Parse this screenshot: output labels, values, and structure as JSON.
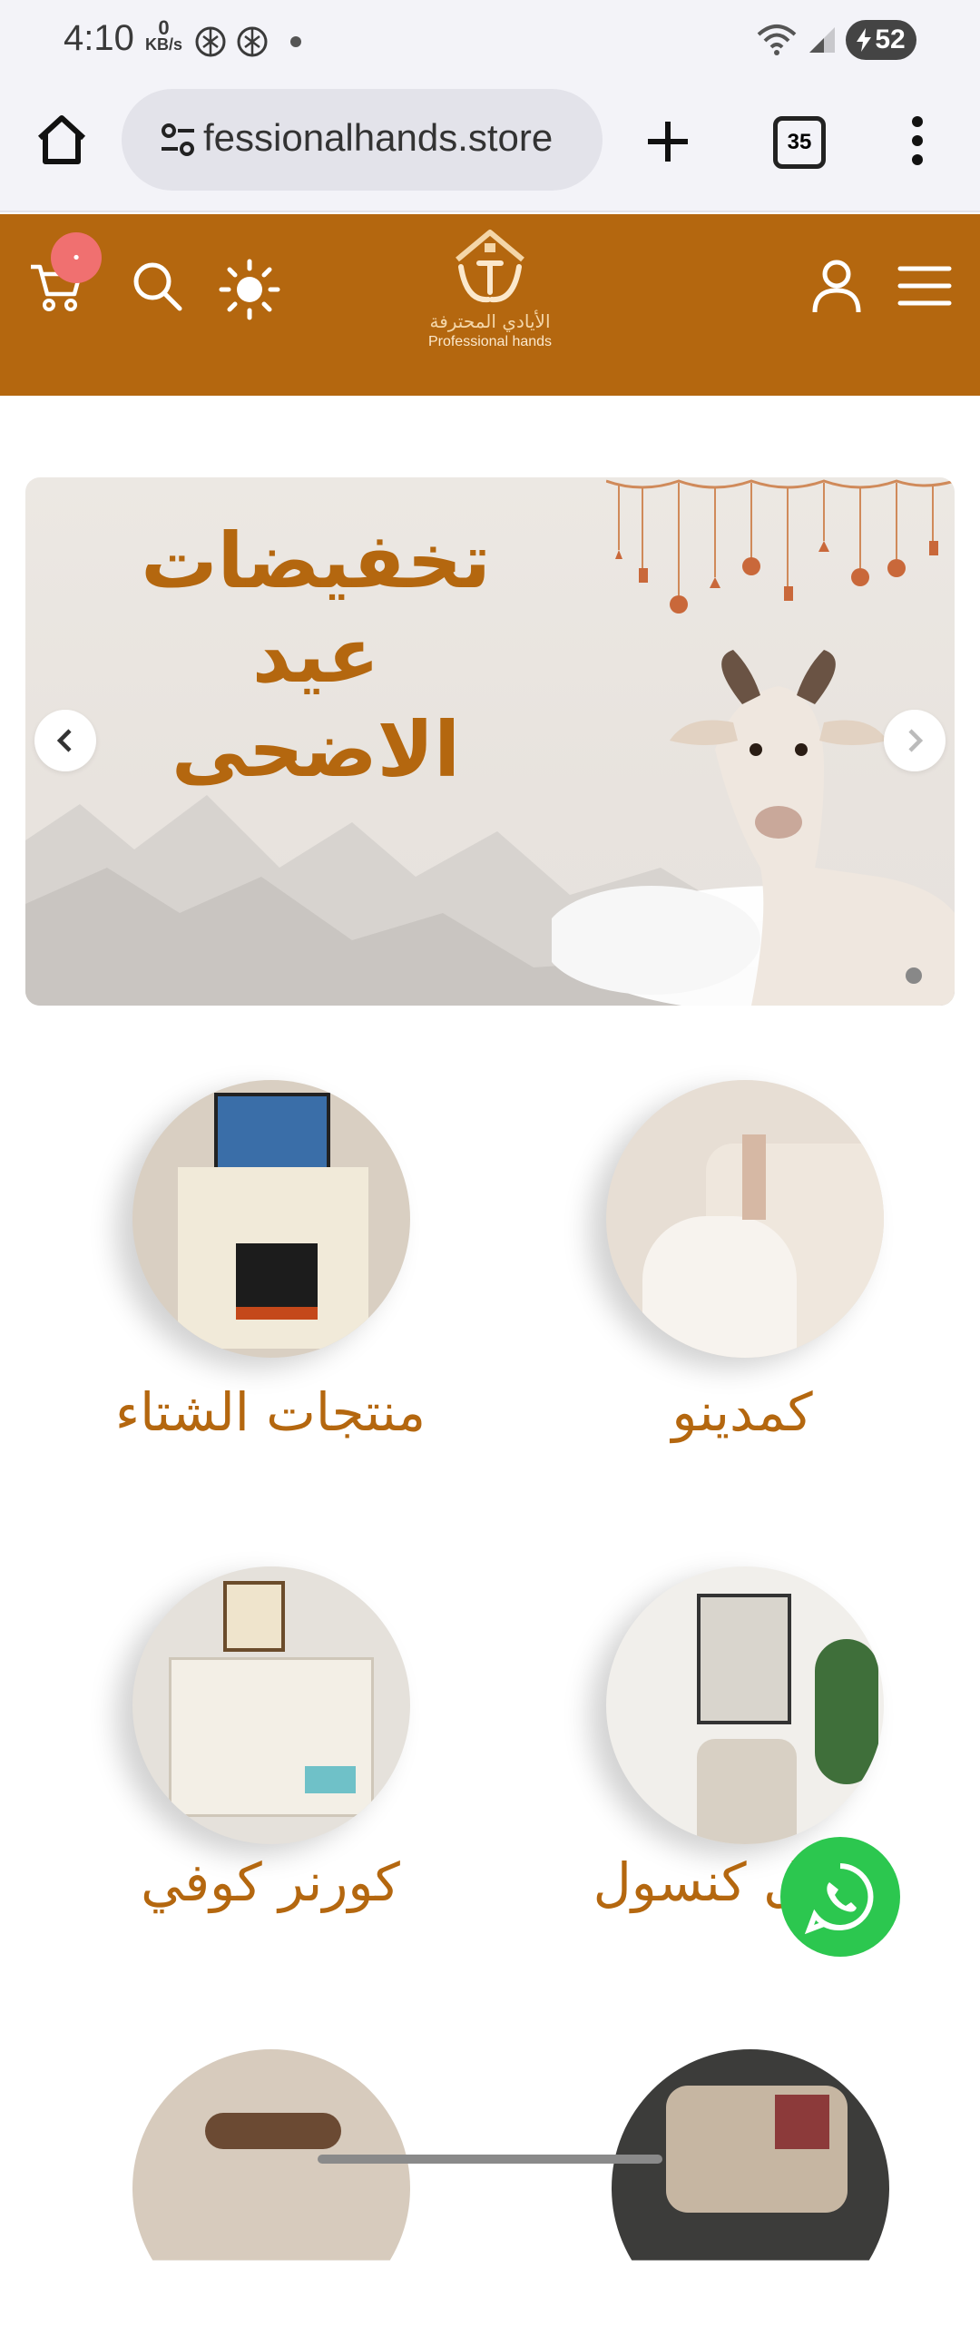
{
  "status_bar": {
    "time": "4:10",
    "net_speed_value": "0",
    "net_speed_unit": "KB/s",
    "battery": "52"
  },
  "browser": {
    "url": "fessionalhands.store",
    "tab_count": "35"
  },
  "header": {
    "logo_ar": "الأيادي المحترفة",
    "logo_en": "Professional hands",
    "cart_badge": "•"
  },
  "banner": {
    "title_lines": [
      "تخفيضات",
      "عيد",
      "الاضحى"
    ]
  },
  "categories": [
    {
      "label": "منتجات الشتاء"
    },
    {
      "label": "كمدينو"
    },
    {
      "label": "كورنر كوفي"
    },
    {
      "label": "مدخل كنسول"
    }
  ],
  "colors": {
    "brand": "#b4670f",
    "whatsapp": "#2cc74f",
    "badge": "#f07070"
  }
}
